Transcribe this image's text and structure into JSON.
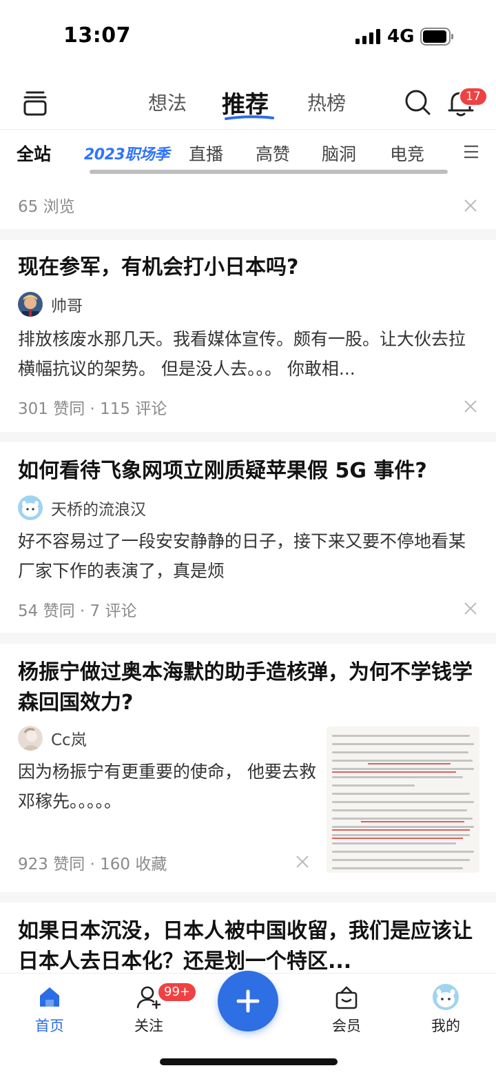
{
  "status_bar": {
    "time": "13:07",
    "network": "4G"
  },
  "top_nav": {
    "tabs": [
      {
        "label": "想法"
      },
      {
        "label": "推荐"
      },
      {
        "label": "热榜"
      }
    ],
    "notification_count": "17",
    "accent_color": "#2b6de5",
    "badge_color": "#f04142"
  },
  "categories": [
    "全站",
    "2023职场季",
    "直播",
    "高赞",
    "脑洞",
    "电竞"
  ],
  "feed": {
    "partial_card": {
      "meta": "65 浏览"
    },
    "cards": [
      {
        "title": "现在参军，有机会打小日本吗?",
        "author": "帅哥",
        "excerpt": "排放核废水那几天。我看媒体宣传。颇有一股。让大伙去拉横幅抗议的架势。 但是没人去。。。 你敢相...",
        "meta": "301 赞同 · 115 评论"
      },
      {
        "title": "如何看待飞象网项立刚质疑苹果假 5G 事件?",
        "author": "天桥的流浪汉",
        "excerpt": "好不容易过了一段安安静静的日子，接下来又要不停地看某厂家下作的表演了，真是烦",
        "meta": "54 赞同 · 7 评论"
      },
      {
        "title": "杨振宁做过奥本海默的助手造核弹，为何不学钱学森回国效力?",
        "author": "Cc岚",
        "excerpt": "因为杨振宁有更重要的使命， 他要去救邓稼先。。。。。",
        "meta": "923 赞同 · 160 收藏"
      },
      {
        "title": "如果日本沉没，日本人被中国收留，我们是应该让日本人去日本化？还是划一个特区..."
      }
    ]
  },
  "bottom_tabs": {
    "home": "首页",
    "follow": "关注",
    "follow_badge": "99+",
    "vip": "会员",
    "me": "我的"
  }
}
